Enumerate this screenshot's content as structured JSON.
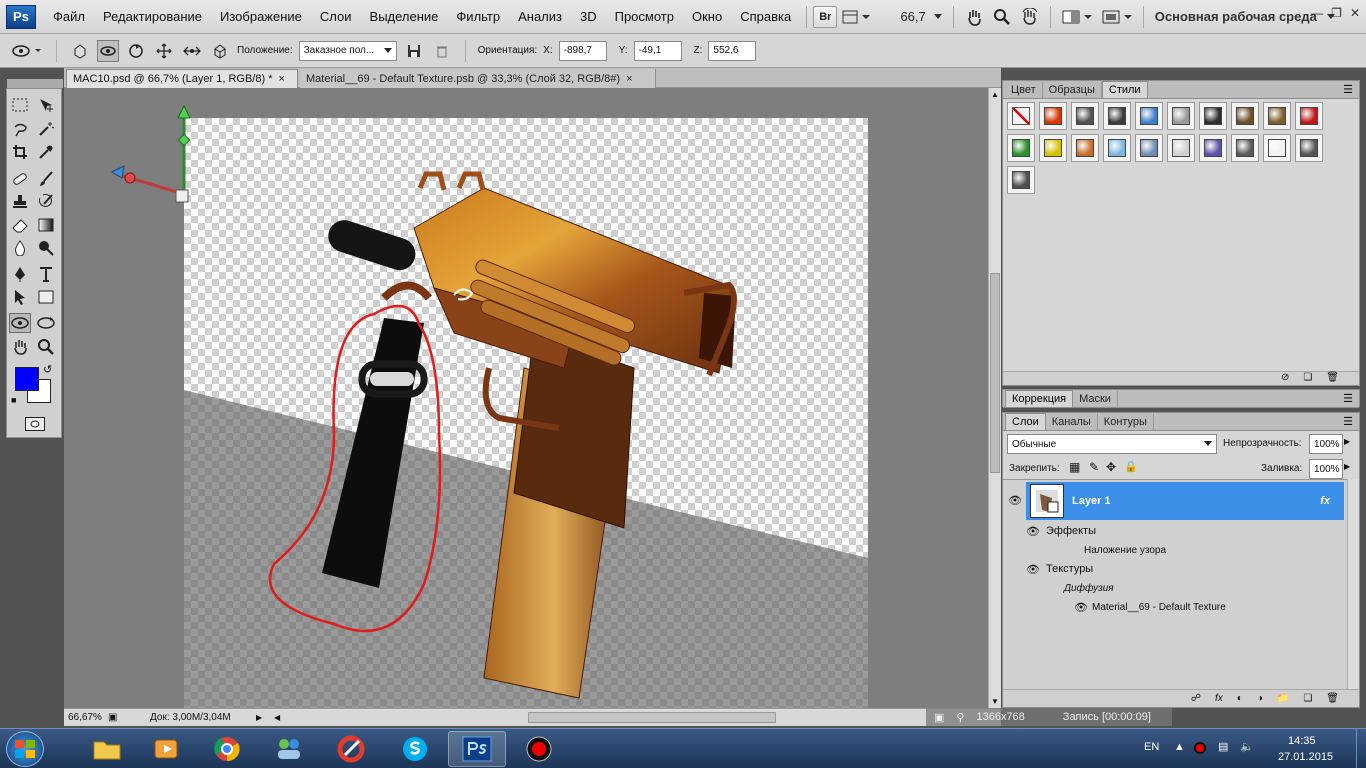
{
  "app": {
    "logo": "Ps"
  },
  "menu": [
    "Файл",
    "Редактирование",
    "Изображение",
    "Слои",
    "Выделение",
    "Фильтр",
    "Анализ",
    "3D",
    "Просмотр",
    "Окно",
    "Справка"
  ],
  "menubar": {
    "bridge": "Br",
    "zoom": "66,7",
    "workspace": "Основная рабочая среда"
  },
  "options": {
    "position_label": "Положение:",
    "position_value": "Заказное пол...",
    "orientation_label": "Ориентация:",
    "x_label": "X:",
    "x_value": "-898,7",
    "y_label": "Y:",
    "y_value": "-49,1",
    "z_label": "Z:",
    "z_value": "552,6"
  },
  "tabs": [
    {
      "label": "MAC10.psd @ 66,7% (Layer 1, RGB/8) *",
      "close": "×"
    },
    {
      "label": "Material__69 - Default Texture.psb @ 33,3% (Слой 32, RGB/8#)",
      "close": "×"
    }
  ],
  "status": {
    "zoom": "66,67%",
    "doc": "Док: 3,00M/3,04M",
    "overlay_res": "1366x768",
    "overlay_rec": "Запись [00:00:09]"
  },
  "colors": {
    "foreground": "#0000ff",
    "background": "#ffffff",
    "layer_selected": "#3c8fe6"
  },
  "styles_panel": {
    "tabs": [
      "Цвет",
      "Образцы",
      "Стили"
    ],
    "swatches": [
      "none",
      "#d33a00",
      "#505050",
      "#3a3a3a",
      "#3d7fcc",
      "#9a9a9a",
      "#2e2e2e",
      "#6b4f2a",
      "#7d5e2e",
      "#c01818",
      "#2b8f2b",
      "#d8c200",
      "#c86e2a",
      "#7fb6e0",
      "#6f8fb2",
      "#d0d0d0",
      "#5a54a8",
      "#5a5a5a",
      "#f2f2f2",
      "#555555",
      "#4e4e4e"
    ]
  },
  "corr_panel": {
    "tabs": [
      "Коррекция",
      "Маски"
    ]
  },
  "layers_panel": {
    "tabs": [
      "Слои",
      "Каналы",
      "Контуры"
    ],
    "blend_mode": "Обычные",
    "opacity_label": "Непрозрачность:",
    "opacity_value": "100%",
    "lock_label": "Закрепить:",
    "fill_label": "Заливка:",
    "fill_value": "100%",
    "layer_name": "Layer 1",
    "fx": "fx",
    "effects": "Эффекты",
    "pattern_overlay": "Наложение узора",
    "textures": "Текстуры",
    "diffuse": "Диффузия",
    "material": "Material__69 - Default Texture"
  },
  "taskbar": {
    "lang": "EN",
    "time": "14:35",
    "date": "27.01.2015"
  }
}
